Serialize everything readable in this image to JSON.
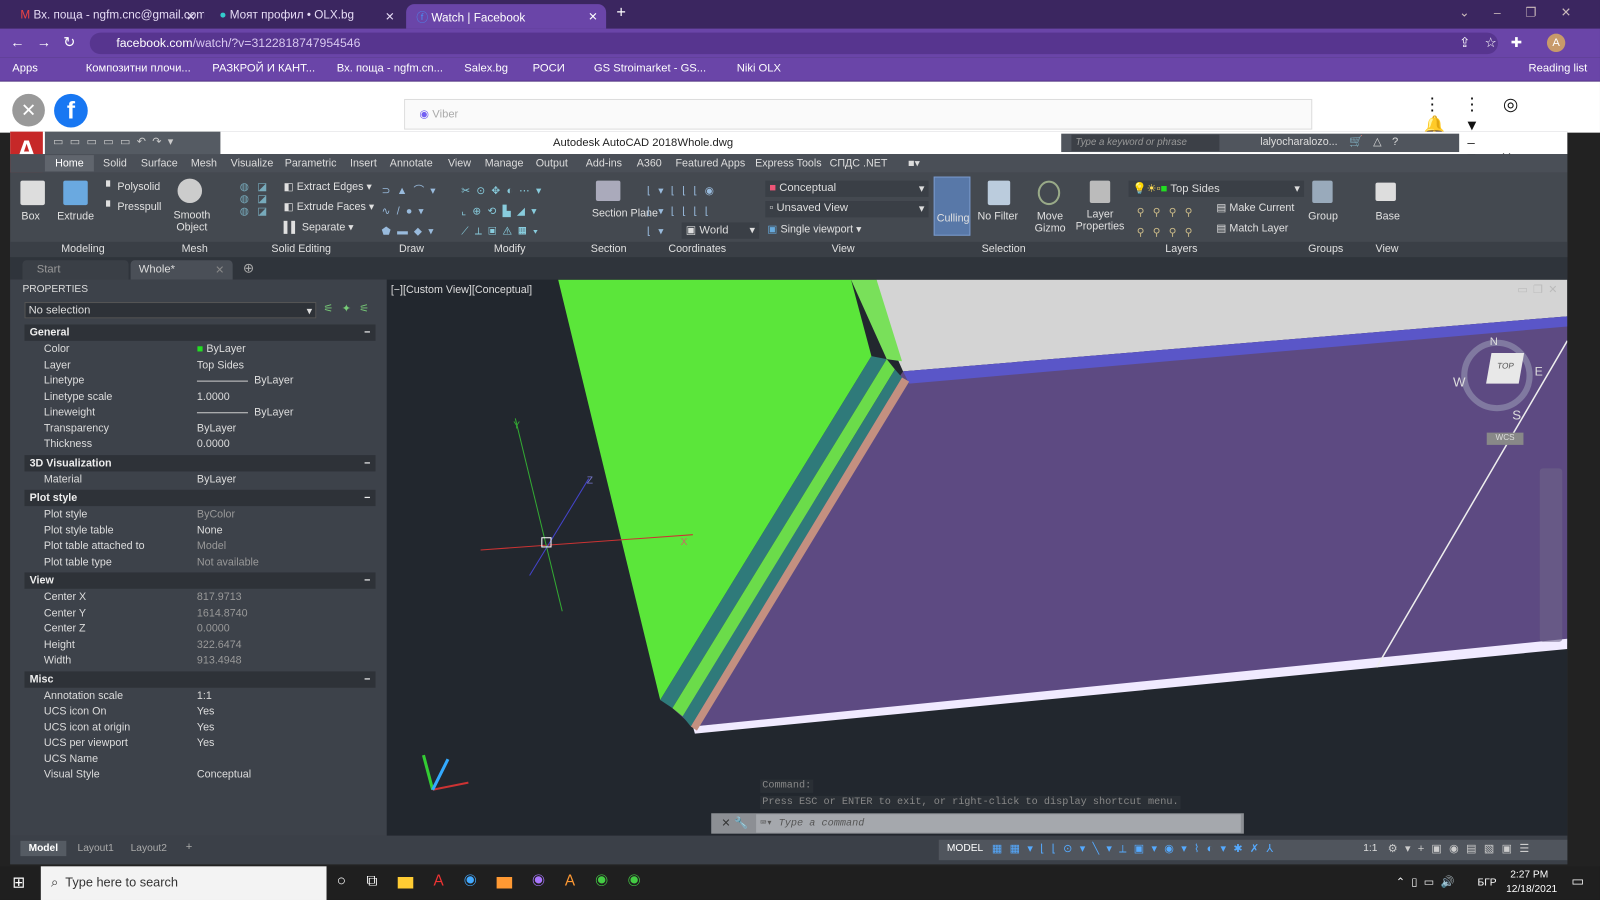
{
  "browser": {
    "tabs": [
      {
        "label": "Вх. поща - ngfm.cnc@gmail.com",
        "icon": "gmail-icon"
      },
      {
        "label": "Моят профил • OLX.bg",
        "icon": "olx-icon"
      },
      {
        "label": "Watch | Facebook",
        "icon": "facebook-icon",
        "active": true
      }
    ],
    "url_domain": "facebook.com",
    "url_path": "/watch/?v=3122818747954546",
    "bookmarks": [
      "Apps",
      "Композитни плочи...",
      "РАЗКРОЙ И КАНТ...",
      "Вх. поща - ngfm.cn...",
      "Salex.bg",
      "РОСИ",
      "GS Stroimarket - GS...",
      "Niki OLX"
    ],
    "reading_list": "Reading list",
    "profile_initial": "A"
  },
  "viber": {
    "title": "Viber"
  },
  "acad": {
    "title": "Autodesk AutoCAD 2018",
    "file": "Whole.dwg",
    "search_placeholder": "Type a keyword or phrase",
    "user": "lalyocharalozo...",
    "menu": [
      "Home",
      "Solid",
      "Surface",
      "Mesh",
      "Visualize",
      "Parametric",
      "Insert",
      "Annotate",
      "View",
      "Manage",
      "Output",
      "Add-ins",
      "A360",
      "Featured Apps",
      "Express Tools",
      "СПДС .NET"
    ],
    "ribbon": {
      "box": "Box",
      "extrude": "Extrude",
      "polysolid": "Polysolid",
      "presspull": "Presspull",
      "smooth_object": "Smooth Object",
      "extract_edges": "Extract Edges",
      "extrude_faces": "Extrude Faces",
      "separate": "Separate",
      "section_plane": "Section Plane",
      "visual_style": "Conceptual",
      "view": "Unsaved View",
      "ucs": "World",
      "viewport": "Single viewport",
      "culling": "Culling",
      "no_filter": "No Filter",
      "move_gizmo": "Move Gizmo",
      "layer_properties": "Layer Properties",
      "layer": "Top Sides",
      "make_current": "Make Current",
      "match_layer": "Match Layer",
      "group": "Group",
      "base": "Base",
      "panels": [
        "Modeling",
        "Mesh",
        "Solid Editing",
        "Draw",
        "Modify",
        "Section",
        "Coordinates",
        "View",
        "Selection",
        "Layers",
        "Groups",
        "View"
      ]
    },
    "doc_tabs": [
      "Start",
      "Whole*"
    ],
    "properties": {
      "title": "PROPERTIES",
      "selection": "No selection",
      "sections": [
        {
          "name": "General",
          "rows": [
            [
              "Color",
              "ByLayer"
            ],
            [
              "Layer",
              "Top Sides"
            ],
            [
              "Linetype",
              "ByLayer"
            ],
            [
              "Linetype scale",
              "1.0000"
            ],
            [
              "Lineweight",
              "ByLayer"
            ],
            [
              "Transparency",
              "ByLayer"
            ],
            [
              "Thickness",
              "0.0000"
            ]
          ]
        },
        {
          "name": "3D Visualization",
          "rows": [
            [
              "Material",
              "ByLayer"
            ]
          ]
        },
        {
          "name": "Plot style",
          "rows": [
            [
              "Plot style",
              "ByColor"
            ],
            [
              "Plot style table",
              "None"
            ],
            [
              "Plot table attached to",
              "Model"
            ],
            [
              "Plot table type",
              "Not available"
            ]
          ]
        },
        {
          "name": "View",
          "rows": [
            [
              "Center X",
              "817.9713"
            ],
            [
              "Center Y",
              "1614.8740"
            ],
            [
              "Center Z",
              "0.0000"
            ],
            [
              "Height",
              "322.6474"
            ],
            [
              "Width",
              "913.4948"
            ]
          ]
        },
        {
          "name": "Misc",
          "rows": [
            [
              "Annotation scale",
              "1:1"
            ],
            [
              "UCS icon On",
              "Yes"
            ],
            [
              "UCS icon at origin",
              "Yes"
            ],
            [
              "UCS per viewport",
              "Yes"
            ],
            [
              "UCS Name",
              ""
            ],
            [
              "Visual Style",
              "Conceptual"
            ]
          ]
        }
      ]
    },
    "viewport_label": "[−][Custom View][Conceptual]",
    "viewcube": {
      "top": "TOP",
      "n": "N",
      "s": "S",
      "e": "E",
      "w": "W",
      "wcs": "WCS"
    },
    "axis": {
      "x": "X",
      "y": "Y",
      "z": "Z"
    },
    "command": {
      "history1": "Command:",
      "history2": "Press ESC or ENTER to exit, or right-click to display shortcut menu.",
      "placeholder": "Type a command"
    },
    "layout_tabs": [
      "Model",
      "Layout1",
      "Layout2"
    ],
    "status": {
      "model": "MODEL",
      "scale": "1:1"
    }
  },
  "taskbar": {
    "search_placeholder": "Type here to search",
    "time": "2:27 PM",
    "date": "12/18/2021",
    "lang": "БГР"
  }
}
